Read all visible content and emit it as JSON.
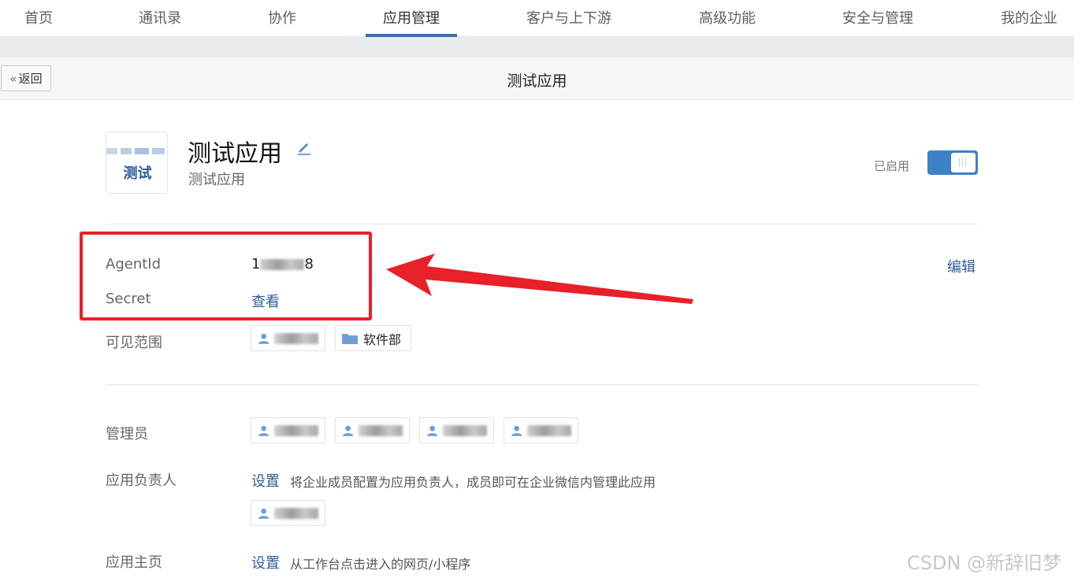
{
  "nav": {
    "items": [
      "首页",
      "通讯录",
      "协作",
      "应用管理",
      "客户与上下游",
      "高级功能",
      "安全与管理",
      "我的企业"
    ],
    "active": "应用管理"
  },
  "subheader": {
    "back_label": "返回",
    "title": "测试应用"
  },
  "app": {
    "icon_text": "测试",
    "name": "测试应用",
    "description": "测试应用",
    "status_label": "已启用",
    "enabled": true
  },
  "credentials": {
    "agentid_label": "AgentId",
    "agentid_value_prefix": "1",
    "agentid_value_suffix": "8",
    "secret_label": "Secret",
    "secret_link": "查看",
    "edit_link": "编辑"
  },
  "visibility": {
    "label": "可见范围",
    "department": "软件部"
  },
  "admins": {
    "label": "管理员"
  },
  "owner": {
    "label": "应用负责人",
    "set_link": "设置",
    "hint": "将企业成员配置为应用负责人，成员即可在企业微信内管理此应用"
  },
  "homepage": {
    "label": "应用主页",
    "set_link": "设置",
    "hint": "从工作台点击进入的网页/小程序"
  },
  "watermark": "CSDN @新辞旧梦",
  "colors": {
    "accent": "#3a6ea5",
    "link": "#2f5e96",
    "toggle_on": "#3d82c6",
    "annotation_red": "#e8202a"
  }
}
